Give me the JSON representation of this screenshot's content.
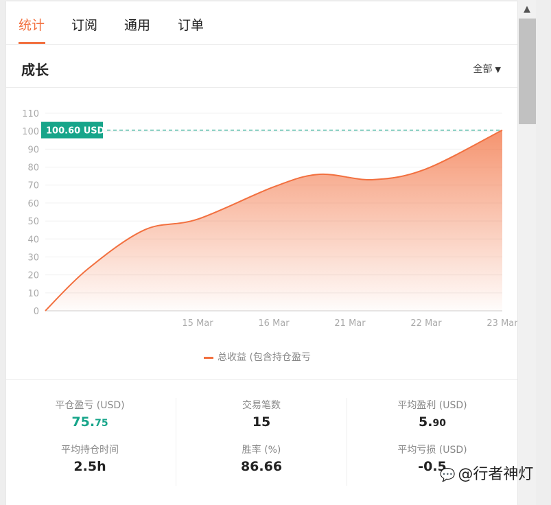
{
  "tabs": [
    {
      "label": "统计",
      "active": true
    },
    {
      "label": "订阅",
      "active": false
    },
    {
      "label": "通用",
      "active": false
    },
    {
      "label": "订单",
      "active": false
    }
  ],
  "section": {
    "title": "成长",
    "filter_label": "全部"
  },
  "chart_data": {
    "type": "area",
    "x_categories": [
      "15 Mar",
      "16 Mar",
      "21 Mar",
      "22 Mar",
      "23 Mar"
    ],
    "yticks": [
      0,
      10,
      20,
      30,
      40,
      50,
      60,
      70,
      80,
      90,
      100,
      110
    ],
    "ylim": [
      0,
      110
    ],
    "grid": true,
    "reference_line": {
      "value": 100.6,
      "label": "100.60 USD",
      "color": "#17a58a"
    },
    "series": [
      {
        "name": "总收益 (包含持仓盈亏",
        "color": "#f2703f",
        "points": [
          {
            "x": 0,
            "y": 0
          },
          {
            "x": 0.55,
            "y": 23
          },
          {
            "x": 1.3,
            "y": 45
          },
          {
            "x": 2.0,
            "y": 51
          },
          {
            "x": 3.0,
            "y": 69
          },
          {
            "x": 3.6,
            "y": 76
          },
          {
            "x": 4.3,
            "y": 73
          },
          {
            "x": 5.0,
            "y": 79
          },
          {
            "x": 6.0,
            "y": 100.6
          }
        ]
      }
    ],
    "legend_position": "bottom"
  },
  "stats": {
    "closed_pnl": {
      "label": "平仓盈亏 (USD)",
      "int": "75.",
      "dec": "75"
    },
    "trades": {
      "label": "交易笔数",
      "value": "15"
    },
    "avg_profit": {
      "label": "平均盈利 (USD)",
      "int": "5.",
      "dec": "90"
    },
    "avg_hold": {
      "label": "平均持仓时间",
      "value": "2.5h"
    },
    "win_rate": {
      "label": "胜率 (%)",
      "value": "86.66"
    },
    "avg_loss": {
      "label": "平均亏损 (USD)",
      "value": "-0.5"
    }
  },
  "watermark": {
    "text": "@行者神灯"
  },
  "colors": {
    "accent": "#f2703f",
    "green": "#17a58a"
  }
}
